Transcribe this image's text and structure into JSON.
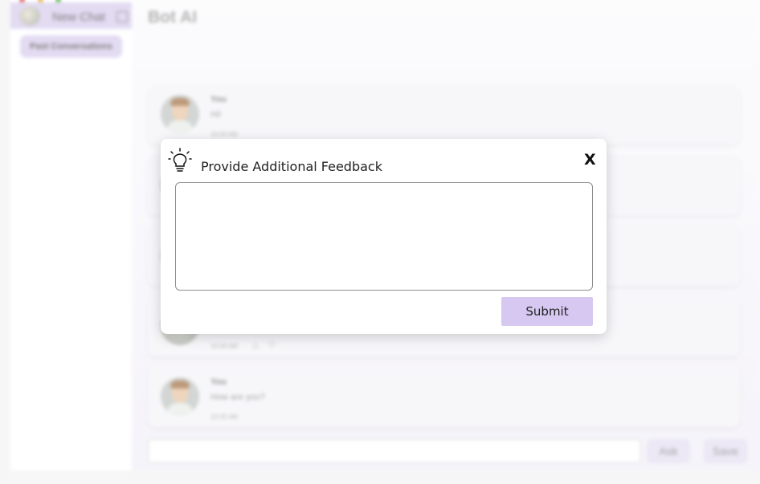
{
  "sidebar": {
    "new_chat_label": "New Chat",
    "past_conversations_label": "Past Conversations"
  },
  "main": {
    "title": "Bot AI",
    "messages": [
      {
        "author": "You",
        "text": "Hi!",
        "time": "10:33 AM"
      },
      {
        "author": "",
        "text": "",
        "time": ""
      },
      {
        "author": "",
        "text": "",
        "time": ""
      },
      {
        "author": "",
        "text": "",
        "time": "10:34 AM"
      },
      {
        "author": "You",
        "text": "How are you?",
        "time": "10:35 AM"
      }
    ],
    "ask_label": "Ask",
    "save_label": "Save"
  },
  "modal": {
    "title": "Provide Additional Feedback",
    "close_label": "X",
    "textarea_value": "",
    "submit_label": "Submit"
  },
  "icons": {
    "logo": "bot-logo-icon",
    "edit": "edit-icon",
    "bulb": "lightbulb-icon",
    "thumbs_up": "thumbs-up-icon",
    "thumbs_down": "thumbs-down-icon"
  },
  "colors": {
    "accent": "#d7c8f2",
    "sidebar_highlight": "#d9cfee"
  }
}
